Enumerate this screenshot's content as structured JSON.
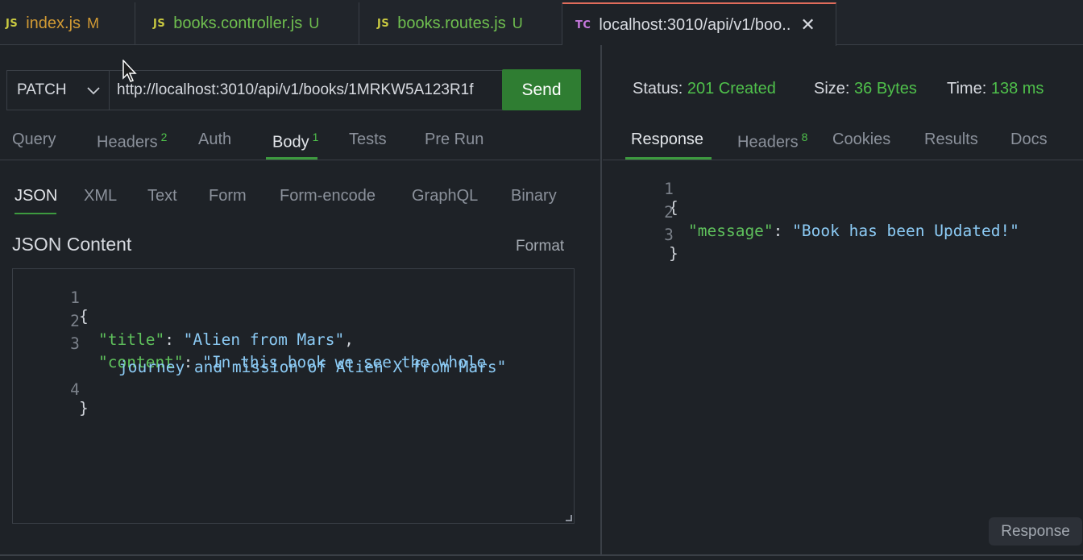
{
  "tabs": [
    {
      "type": "JS",
      "name": "index.js",
      "badge": "M",
      "color": "#d19a34",
      "badge_color": "#d19a34",
      "type_color": "#cbcb41"
    },
    {
      "type": "JS",
      "name": "books.controller.js",
      "badge": "U",
      "color": "#6fbf4f",
      "badge_color": "#6fbf4f",
      "type_color": "#cbcb41"
    },
    {
      "type": "JS",
      "name": "books.routes.js",
      "badge": "U",
      "color": "#6fbf4f",
      "badge_color": "#6fbf4f",
      "type_color": "#cbcb41"
    },
    {
      "type": "TC",
      "name": "localhost:3010/api/v1/boo..",
      "close": "✕",
      "color": "#d7dae0",
      "type_color": "#c678dd"
    }
  ],
  "request": {
    "method": "PATCH",
    "url": "http://localhost:3010/api/v1/books/1MRKW5A123R1f",
    "send_label": "Send"
  },
  "request_tabs": [
    {
      "label": "Query"
    },
    {
      "label": "Headers",
      "count": "2"
    },
    {
      "label": "Auth"
    },
    {
      "label": "Body",
      "count": "1"
    },
    {
      "label": "Tests"
    },
    {
      "label": "Pre Run"
    }
  ],
  "body_tabs": [
    "JSON",
    "XML",
    "Text",
    "Form",
    "Form-encode",
    "GraphQL",
    "Binary"
  ],
  "json_content_label": "JSON Content",
  "format_label": "Format",
  "request_body_lines": [
    {
      "num": "1",
      "text": "{"
    },
    {
      "num": "2",
      "key": "\"title\"",
      "sep": ": ",
      "value": "\"Alien from Mars\"",
      "end": ","
    },
    {
      "num": "3",
      "key": "\"content\"",
      "sep": ": ",
      "value": "\"In this book we see the whole",
      "end": ""
    },
    {
      "num": "",
      "value": "journey and mission of Alien X from Mars\""
    },
    {
      "num": "4",
      "text": "}"
    }
  ],
  "status": {
    "status_label": "Status:",
    "status_value": "201 Created",
    "size_label": "Size:",
    "size_value": "36 Bytes",
    "time_label": "Time:",
    "time_value": "138 ms"
  },
  "response_tabs": [
    {
      "label": "Response"
    },
    {
      "label": "Headers",
      "count": "8"
    },
    {
      "label": "Cookies"
    },
    {
      "label": "Results"
    },
    {
      "label": "Docs"
    }
  ],
  "response_body_lines": [
    {
      "num": "1",
      "text": "{"
    },
    {
      "num": "2",
      "key": "\"message\"",
      "sep": ": ",
      "value": "\"Book has been Updated!\""
    },
    {
      "num": "3",
      "text": "}"
    }
  ],
  "response_button": "Response",
  "colors": {
    "accent_green": "#2f7d32",
    "active_tab_border": "#e06c5b",
    "background": "#1e2227"
  }
}
